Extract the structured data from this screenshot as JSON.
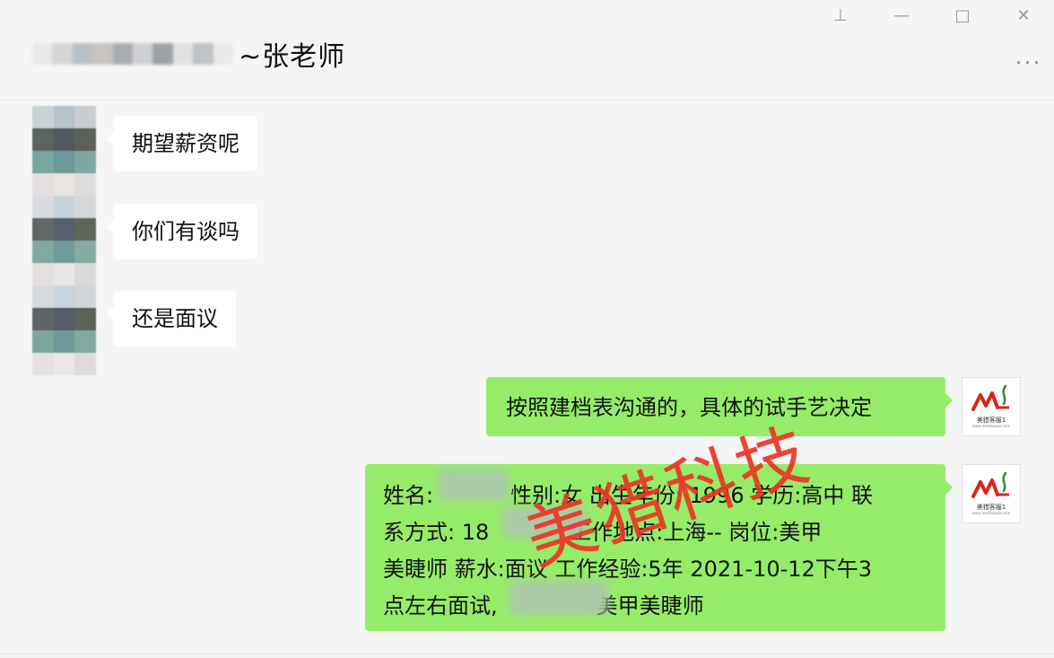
{
  "header": {
    "title": "~张老师",
    "blurred_name_colors": [
      "#e8e8e8",
      "#d6d6d6",
      "#b7c0c6",
      "#c9c2bd",
      "#a9adb3",
      "#cfd0d2",
      "#9ba3a8",
      "#e0e0e0",
      "#bfc3c5",
      "#e9e9e9"
    ],
    "window_buttons": {
      "pin": "⊥",
      "minimize": "—",
      "maximize": "□",
      "close": "✕"
    },
    "more": "..."
  },
  "messages": [
    {
      "side": "incoming",
      "text": "期望薪资呢"
    },
    {
      "side": "incoming",
      "text": "你们有谈吗"
    },
    {
      "side": "incoming",
      "text": "还是面议"
    },
    {
      "side": "outgoing",
      "text": "按照建档表沟通的，具体的试手艺决定"
    },
    {
      "side": "outgoing",
      "lines": [
        "姓名:",
        "性别:女 出生年份: 1996 学历:高中 联",
        "系方式: 18",
        "工作地点:上海-- 岗位:美甲",
        "美睫师 薪水:面议 工作经验:5年 2021-10-12下午3",
        "点左右面试,",
        "美甲美睫师"
      ]
    }
  ],
  "avatar": {
    "brand_text": "美猎客服1",
    "sub_text": "www.meilieaaaa.com",
    "icon": "brand-logo-icon"
  },
  "watermark": "美猎科技",
  "colors": {
    "outgoing_bubble": "#95ec69",
    "incoming_bubble": "#ffffff",
    "background": "#f5f5f5",
    "watermark": "#ee3424"
  }
}
